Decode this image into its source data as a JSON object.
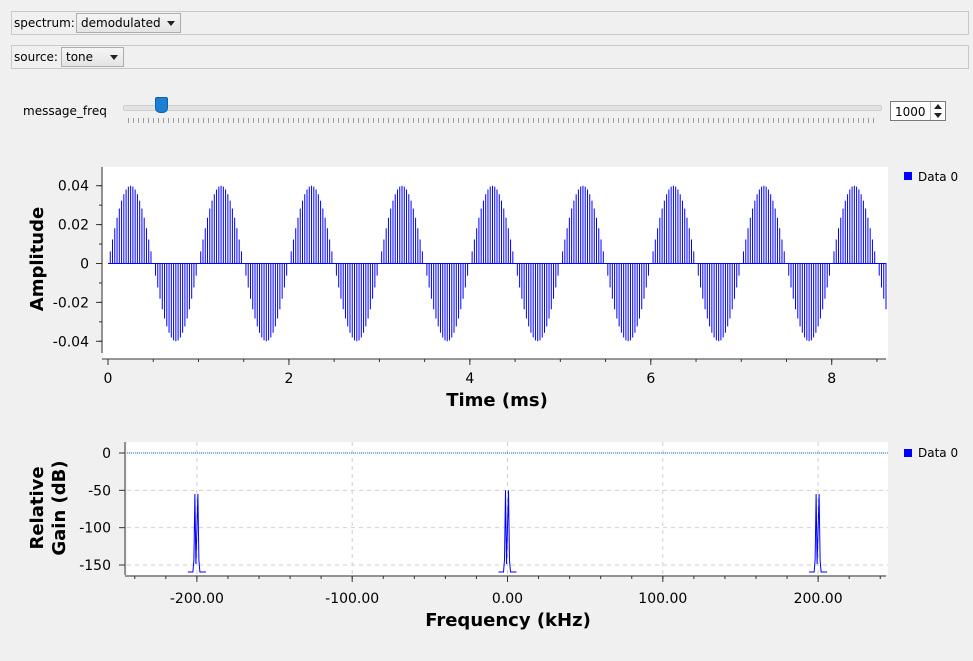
{
  "controls": {
    "spectrum": {
      "label": "spectrum:",
      "value": "demodulated"
    },
    "source": {
      "label": "source:",
      "value": "tone"
    },
    "message_freq": {
      "label": "message_freq",
      "value": "1000",
      "slider_fraction": 0.04
    }
  },
  "colors": {
    "trace": "#0000ff",
    "accent": "#1c7fd6"
  },
  "chart_data": [
    {
      "type": "line",
      "xlabel": "Time (ms)",
      "ylabel": "Amplitude",
      "xlim": [
        0,
        8.6
      ],
      "ylim": [
        -0.045,
        0.045
      ],
      "xticks": [
        0,
        2,
        4,
        6,
        8
      ],
      "xtick_labels": [
        "0",
        "2",
        "4",
        "6",
        "8"
      ],
      "yticks": [
        0.04,
        0.02,
        0,
        -0.02,
        -0.04
      ],
      "ytick_labels": [
        "0.04",
        "0.02",
        "0",
        "-0.02",
        "-0.04"
      ],
      "grid": false,
      "legend": "right",
      "series": [
        {
          "name": "Data 0",
          "signal": "half-wave AM tone",
          "envelope_amplitude": 0.04,
          "envelope_frequency_khz": 1.0,
          "sample_rate_khz": 40
        }
      ]
    },
    {
      "type": "line",
      "xlabel": "Frequency (kHz)",
      "ylabel": "Relative Gain (dB)",
      "xlim": [
        -245,
        245
      ],
      "ylim": [
        -165,
        5
      ],
      "xticks": [
        -200,
        -100,
        0,
        100,
        200
      ],
      "xtick_labels": [
        "-200.00",
        "-100.00",
        "0.00",
        "100.00",
        "200.00"
      ],
      "yticks": [
        0,
        -50,
        -100,
        -150
      ],
      "ytick_labels": [
        "0",
        "-50",
        "-100",
        "-150"
      ],
      "grid": true,
      "legend": "right",
      "series": [
        {
          "name": "Data 0",
          "baseline_db": 0,
          "peaks_khz": [
            -200,
            0,
            200
          ],
          "peak_db": [
            -55,
            -50,
            -55
          ],
          "floor_db": -165
        }
      ]
    }
  ]
}
